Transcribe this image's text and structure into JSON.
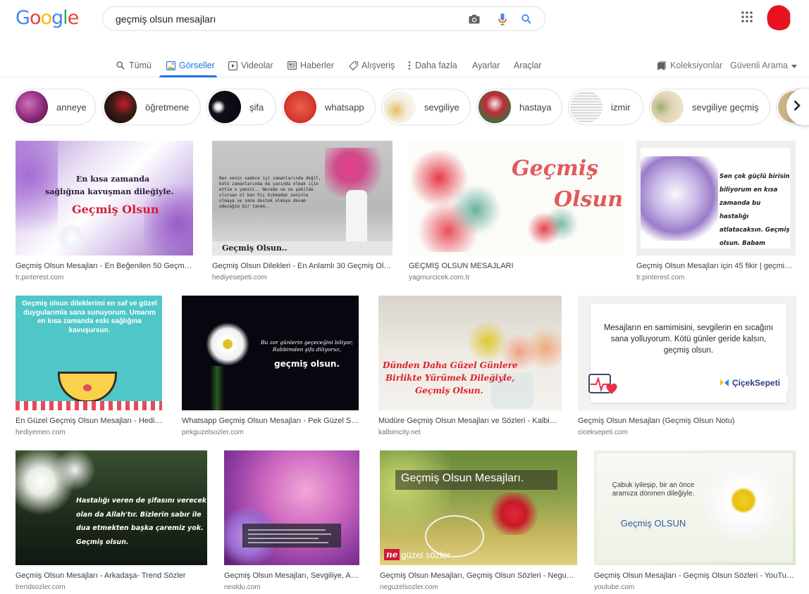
{
  "header": {
    "logo_letters": [
      "G",
      "o",
      "o",
      "g",
      "l",
      "e"
    ],
    "logo_colors": [
      "#4285f4",
      "#ea4335",
      "#fbbc05",
      "#4285f4",
      "#34a853",
      "#ea4335"
    ],
    "search_value": "geçmiş olsun mesajları",
    "icons": [
      "camera-icon",
      "mic-icon",
      "search-icon",
      "apps-icon"
    ],
    "avatar_color": "#e8121e"
  },
  "tabs": {
    "items": [
      {
        "label": "Tümü",
        "icon": "search-icon",
        "active": false
      },
      {
        "label": "Görseller",
        "icon": "images-icon",
        "active": true
      },
      {
        "label": "Videolar",
        "icon": "video-icon",
        "active": false
      },
      {
        "label": "Haberler",
        "icon": "news-icon",
        "active": false
      },
      {
        "label": "Alışveriş",
        "icon": "tag-icon",
        "active": false
      },
      {
        "label": "Daha fazla",
        "icon": "more-vert-icon",
        "active": false
      }
    ],
    "settings": "Ayarlar",
    "tools": "Araçlar",
    "collections": "Koleksiyonlar",
    "safe_search": "Güvenli Arama",
    "active_color": "#1a73e8"
  },
  "chips": [
    {
      "label": "anneye",
      "color": "#8b2a7a"
    },
    {
      "label": "öğretmene",
      "color": "#2a1a14"
    },
    {
      "label": "şifa",
      "color": "#10101a"
    },
    {
      "label": "whatsapp",
      "color": "#d94a3a"
    },
    {
      "label": "sevgiliye",
      "color": "#efe6d8"
    },
    {
      "label": "hastaya",
      "color": "#7a3a3a"
    },
    {
      "label": "izmir",
      "color": "#e8e8e8"
    },
    {
      "label": "sevgiliye geçmiş",
      "color": "#d8c8a8"
    }
  ],
  "results": [
    {
      "title": "Geçmiş Olsun Mesajları - En Beğenilen 50 Geçmiş ...",
      "source": "tr.pinterest.com",
      "overlay": [
        "En kısa zamanda",
        "sağlığına kavuşman dileğiyle.",
        "Geçmiş Olsun"
      ]
    },
    {
      "title": "Geçmiş Olsun Dilekleri - En Anlamlı 30 Geçmiş Olsun ...",
      "source": "hediyesepeti.com",
      "overlay": [
        "Ben senin sadece iyi zamanlarında değil, kötü zamanlarında da yanında olmak için ettim o yemini.. Nerede ve ne şekilde olursan ol ben hiç bıkmadan seninle olmaya ve sana destek olmaya devam edeceğim bir tanem..",
        "Geçmiş Olsun.."
      ]
    },
    {
      "title": "GEÇMİŞ OLSUN MESAJLARI",
      "source": "yagmurcicek.com.tr",
      "overlay": [
        "Geçmiş",
        "Olsun"
      ]
    },
    {
      "title": "Geçmiş Olsun Mesajları için 45 fikir | geçmiş ...",
      "source": "tr.pinterest.com",
      "overlay": [
        "Sen çok güçlü birisin biliyorum en kısa zamanda bu hastalığı atlatacaksın. Geçmiş olsun. Babam"
      ]
    },
    {
      "title": "En Güzel Geçmiş Olsun Mesajları - Hediyemen ...",
      "source": "hediyemen.com",
      "overlay": [
        "Geçmiş olsun dileklerimi en saf ve güzel duygularımla sana sunuyorum. Umarım en kısa zamanda eski sağlığına kavuşursun."
      ]
    },
    {
      "title": "Whatsapp Geçmiş Olsun Mesajları - Pek Güzel Sözler",
      "source": "pekguzelsozler.com",
      "overlay": [
        "Bu zor günlerin geçeceğini biliyor, Rabbimden şifa diliyoruz,",
        "geçmiş olsun."
      ]
    },
    {
      "title": "Müdüre Geçmiş Olsun Mesajları ve Sözleri - Kalbim ...",
      "source": "kalbimcity.net",
      "overlay": [
        "Dünden Daha Güzel Günlere",
        "Birlikte Yürümek Dileğiyle,",
        "Geçmiş Olsun."
      ]
    },
    {
      "title": "Geçmiş Olsun Mesajları (Geçmiş Olsun Notu)",
      "source": "ciceksepeti.com",
      "overlay": [
        "Mesajların en samimisini, sevgilerin en sıcağını sana yolluyorum. Kötü günler geride kalsın, geçmiş olsun.",
        "ÇiçekSepeti"
      ]
    },
    {
      "title": "Geçmiş Olsun Mesajları - Arkadaşa- Trend Sözler",
      "source": "trendsozler.com",
      "overlay": [
        "Hastalığı veren de şifasını verecek olan da Allah'tır. Bizlerin sabır ile dua etmekten başka çaremiz yok. Geçmiş olsun."
      ]
    },
    {
      "title": "Geçmiş Olsun Mesajları, Sevgiliye, Aile ...",
      "source": "neoldu.com",
      "overlay": []
    },
    {
      "title": "Geçmiş Olsun Mesajları, Geçmiş Olsun Sözleri - Neguzel...",
      "source": "neguzelsozler.com",
      "overlay": [
        "Geçmiş Olsun Mesajları.",
        "güzel sözler"
      ]
    },
    {
      "title": "Geçmiş Olsun Mesajları - Geçmiş Olsun Sözleri - YouTube",
      "source": "youtube.com",
      "overlay": [
        "Çabuk iyileşip, bir an önce aramıza dönmen dileğiyle.",
        "Geçmiş OLSUN"
      ]
    }
  ]
}
